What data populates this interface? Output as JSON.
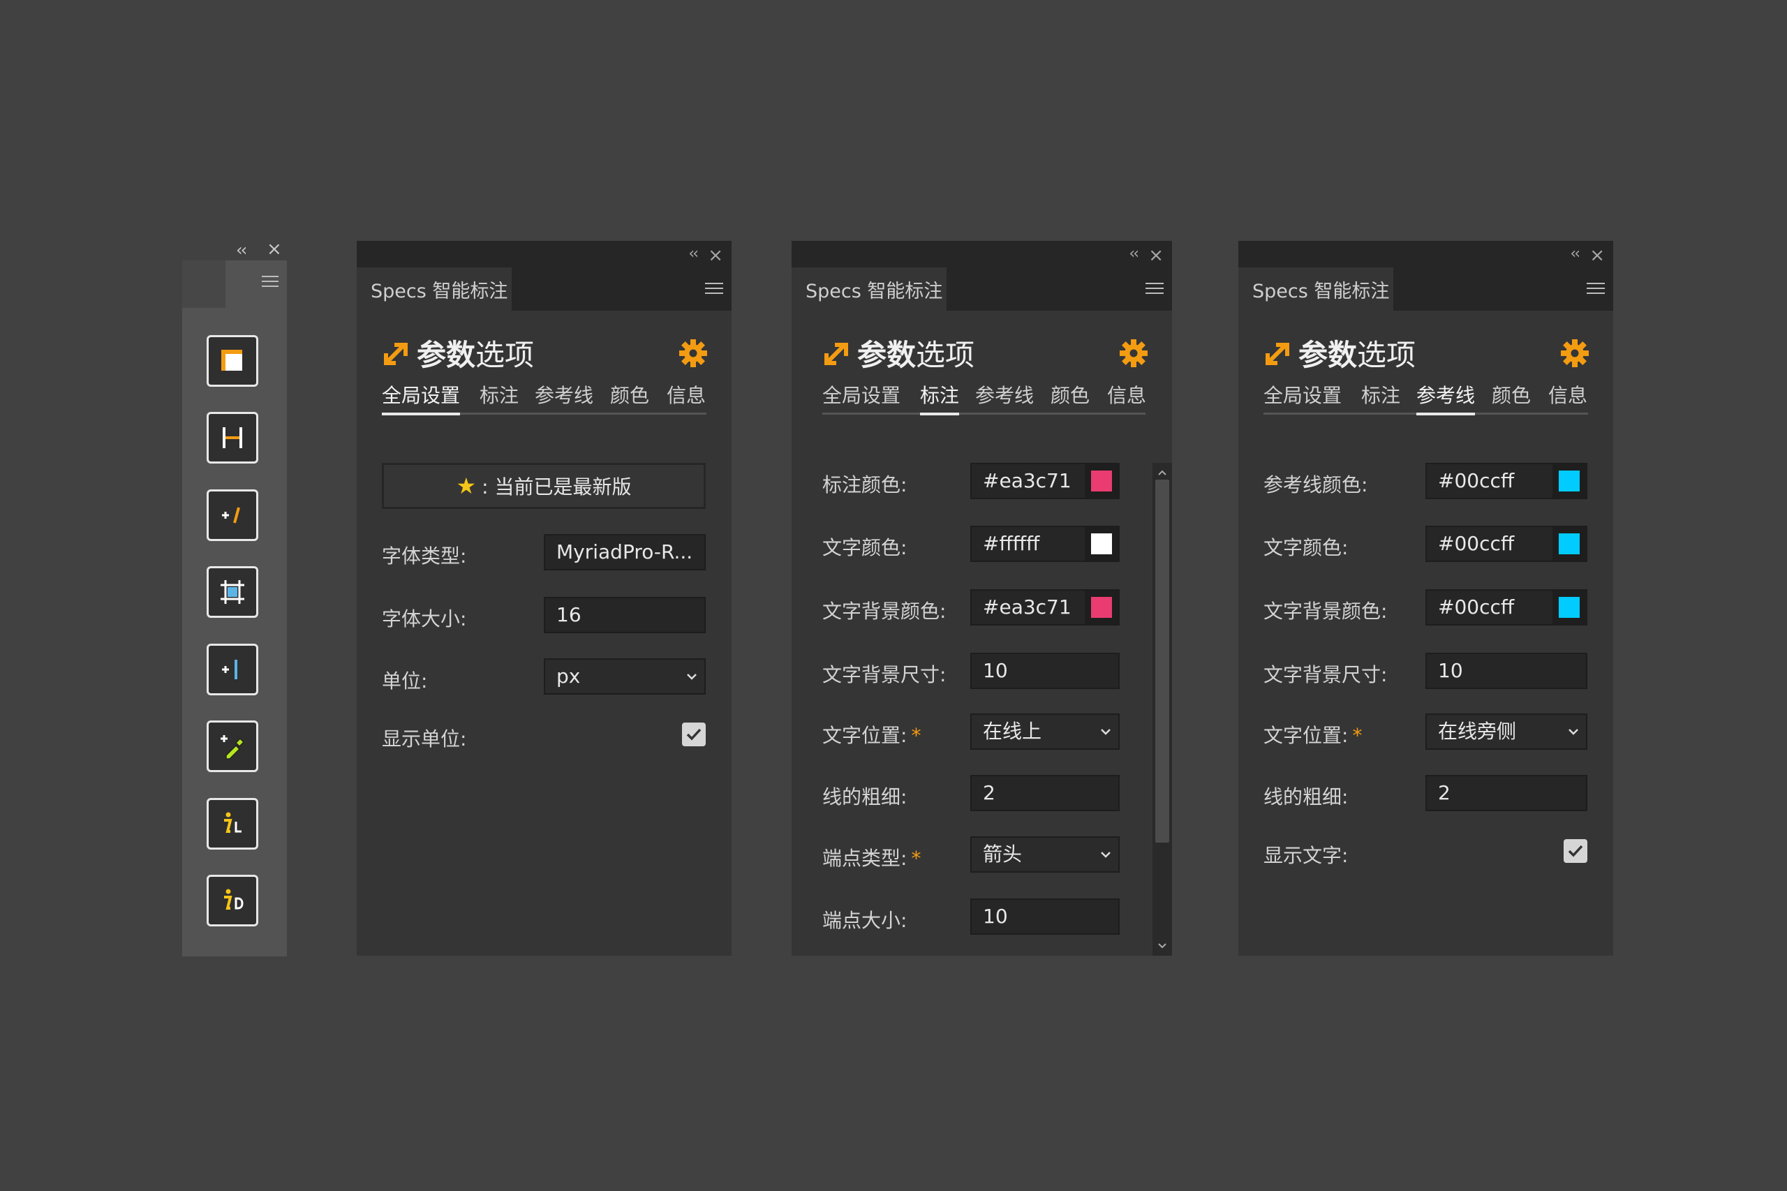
{
  "toolbar": {
    "collapse_label": "‹‹",
    "close_label": "×",
    "tools": [
      {
        "name": "layer-spec-tool-icon"
      },
      {
        "name": "spacing-spec-tool-icon"
      },
      {
        "name": "add-measure-tool-icon"
      },
      {
        "name": "artboard-bounds-tool-icon"
      },
      {
        "name": "add-guide-tool-icon"
      },
      {
        "name": "color-picker-tool-icon"
      },
      {
        "name": "layer-info-tool-icon"
      },
      {
        "name": "doc-info-tool-icon"
      }
    ]
  },
  "panel_common": {
    "tab_title": "Specs 智能标注",
    "collapse_label": "‹‹",
    "close_label": "×",
    "title_bold": "参数",
    "title_rest": "选项",
    "tabs": [
      "全局设置",
      "标注",
      "参考线",
      "颜色",
      "信息"
    ]
  },
  "panel1": {
    "notice_star": "★",
    "notice_text": ": 当前已是最新版",
    "font_type_label": "字体类型:",
    "font_type_value": "MyriadPro-R...",
    "font_size_label": "字体大小:",
    "font_size_value": "16",
    "unit_label": "单位:",
    "unit_value": "px",
    "show_unit_label": "显示单位:",
    "show_unit_checked": true
  },
  "panel2": {
    "rows": {
      "spec_color": {
        "label": "标注颜色:",
        "value": "#ea3c71",
        "swatch": "#ea3c71"
      },
      "text_color": {
        "label": "文字颜色:",
        "value": "#ffffff",
        "swatch": "#ffffff"
      },
      "text_bg_color": {
        "label": "文字背景颜色:",
        "value": "#ea3c71",
        "swatch": "#ea3c71"
      },
      "text_bg_size": {
        "label": "文字背景尺寸:",
        "value": "10"
      },
      "text_position": {
        "label": "文字位置:",
        "required": "*",
        "value": "在线上"
      },
      "line_width": {
        "label": "线的粗细:",
        "value": "2"
      },
      "endpoint_type": {
        "label": "端点类型:",
        "required": "*",
        "value": "箭头"
      },
      "endpoint_size": {
        "label": "端点大小:",
        "value": "10"
      }
    }
  },
  "panel3": {
    "rows": {
      "guide_color": {
        "label": "参考线颜色:",
        "value": "#00ccff",
        "swatch": "#00ccff"
      },
      "text_color": {
        "label": "文字颜色:",
        "value": "#00ccff",
        "swatch": "#00ccff"
      },
      "text_bg_color": {
        "label": "文字背景颜色:",
        "value": "#00ccff",
        "swatch": "#00ccff"
      },
      "text_bg_size": {
        "label": "文字背景尺寸:",
        "value": "10"
      },
      "text_position": {
        "label": "文字位置:",
        "required": "*",
        "value": "在线旁侧"
      },
      "line_width": {
        "label": "线的粗细:",
        "value": "2"
      },
      "show_text": {
        "label": "显示文字:",
        "checked": true
      }
    }
  },
  "colors": {
    "accent": "#f39c12",
    "app_bg": "#414141",
    "panel_bg": "#353535"
  }
}
